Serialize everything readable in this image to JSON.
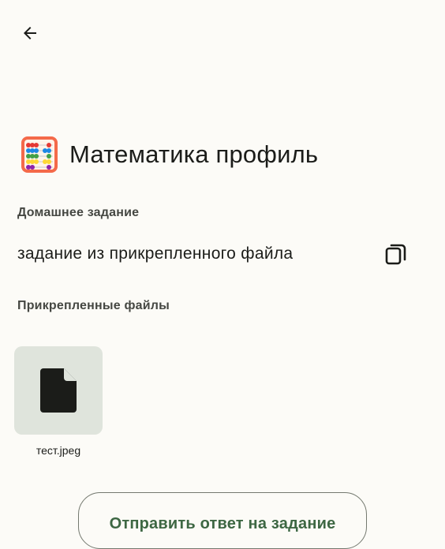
{
  "header": {
    "back_icon": "arrow-back-icon"
  },
  "subject": {
    "icon": "abacus-icon",
    "title": "Математика профиль"
  },
  "homework": {
    "section_label": "Домашнее задание",
    "text": "задание из прикрепленного файла",
    "copy_icon": "copy-icon"
  },
  "attachments": {
    "section_label": "Прикрепленные файлы",
    "files": [
      {
        "name": "тест.jpeg",
        "icon": "file-icon"
      }
    ]
  },
  "actions": {
    "submit_label": "Отправить ответ на задание"
  },
  "colors": {
    "background": "#fcfbf7",
    "accent": "#3d6743",
    "file_card": "#dfe4dc",
    "outline": "#74796f"
  }
}
